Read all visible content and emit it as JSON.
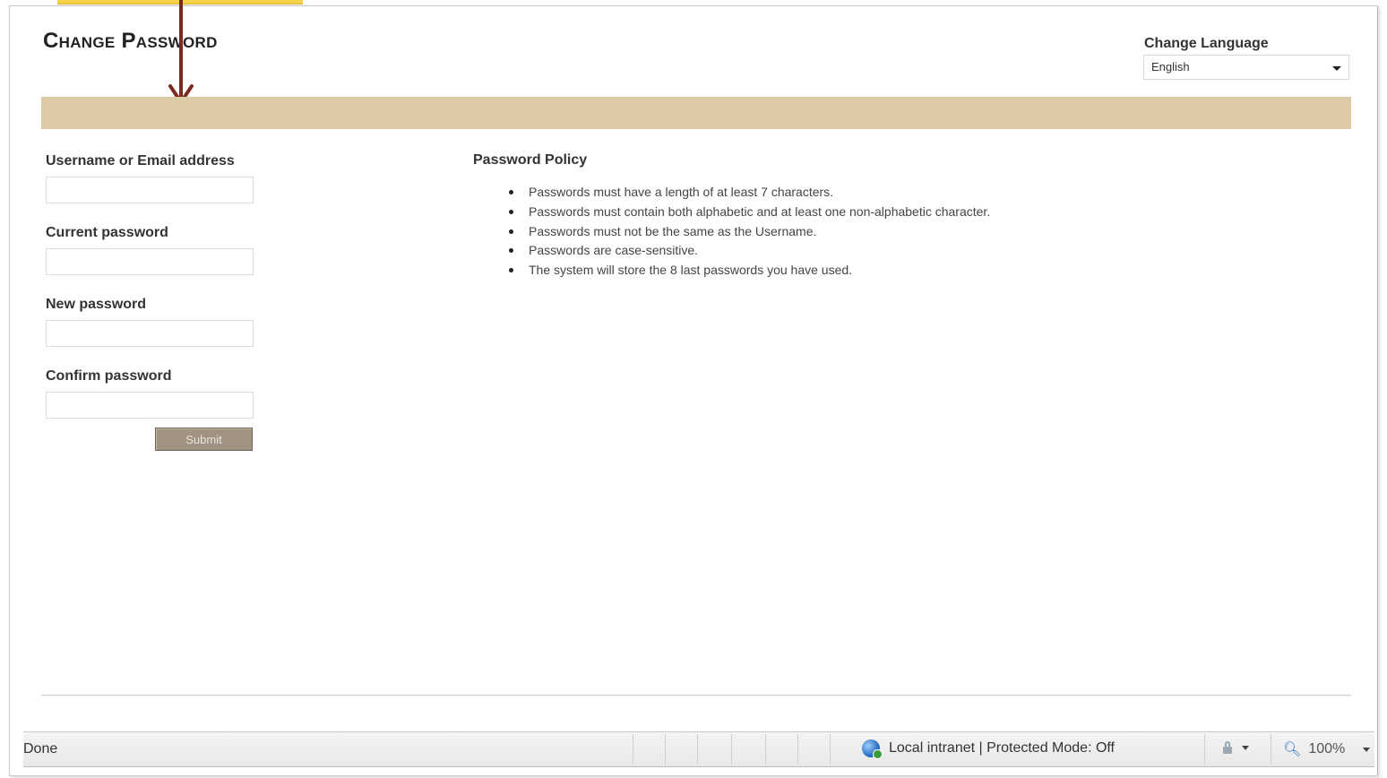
{
  "page": {
    "title": "Change Password"
  },
  "language": {
    "label": "Change Language",
    "selected": "English"
  },
  "form": {
    "fields": [
      {
        "label": "Username or Email address",
        "value": ""
      },
      {
        "label": "Current password",
        "value": ""
      },
      {
        "label": "New password",
        "value": ""
      },
      {
        "label": "Confirm password",
        "value": ""
      }
    ],
    "submit_label": "Submit"
  },
  "policy": {
    "title": "Password Policy",
    "items": [
      "Passwords must have a length of at least 7 characters.",
      "Passwords must contain both alphabetic and at least one non-alphabetic character.",
      "Passwords must not be the same as the Username.",
      "Passwords are case-sensitive.",
      "The system will store the 8 last passwords you have used."
    ]
  },
  "statusbar": {
    "status": "Done",
    "zone": "Local intranet | Protected Mode: Off",
    "zoom": "100%"
  },
  "colors": {
    "band": "#dcc9a6",
    "submit": "#a09382",
    "arrow": "#7a2a1e",
    "callout": "#f7d14a"
  },
  "icons": [
    "down-arrow-annotation-icon",
    "chevron-down-icon",
    "globe-icon",
    "lock-icon",
    "zoom-icon"
  ]
}
